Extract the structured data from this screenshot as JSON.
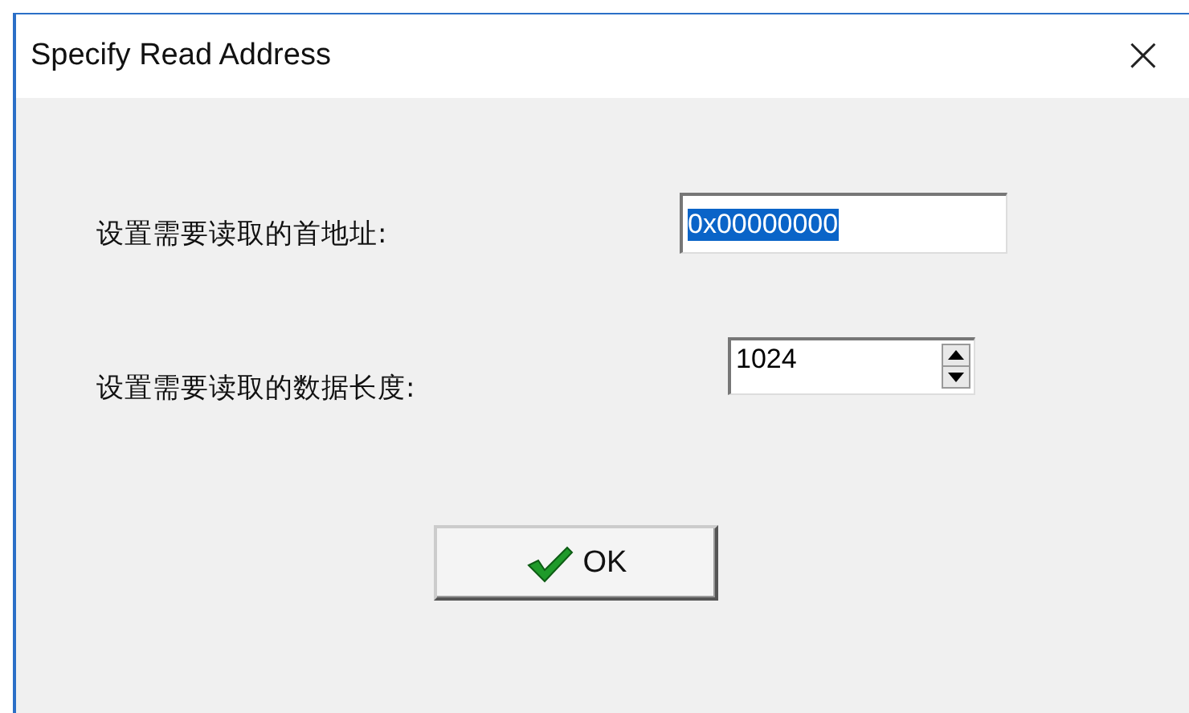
{
  "window": {
    "title": "Specify Read Address",
    "close": "×"
  },
  "fields": [
    {
      "kind": "text",
      "label": "设置需要读取的首地址:",
      "value": "0x00000000",
      "text_selected": true
    },
    {
      "kind": "spin",
      "label": "设置需要读取的数据长度:",
      "value": "1024",
      "text_selected": false
    }
  ],
  "buttons": [
    {
      "label": "OK"
    }
  ]
}
